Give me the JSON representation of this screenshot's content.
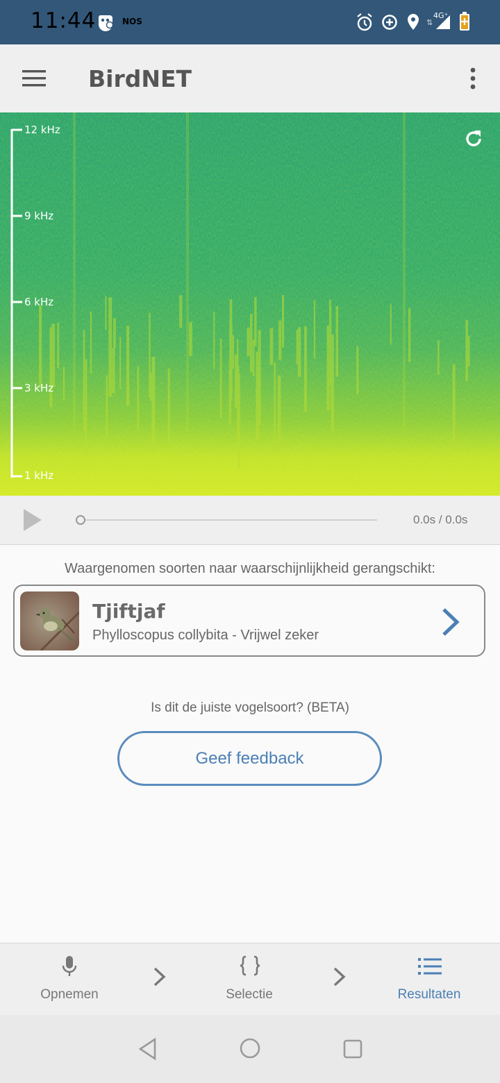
{
  "status_bar": {
    "time": "11:44",
    "carrier_badge": "NOS",
    "network": "4G⁺",
    "icons": [
      "game-icon",
      "alarm-icon",
      "data-saver-icon",
      "location-icon",
      "signal-icon",
      "battery-icon"
    ]
  },
  "app_bar": {
    "title": "BirdNET",
    "icons": [
      "menu-icon",
      "more-vert-icon"
    ]
  },
  "spectrogram": {
    "axis_labels": [
      "12 kHz",
      "9 kHz",
      "6 kHz",
      "3 kHz",
      "1 kHz"
    ],
    "icon": "refresh-icon"
  },
  "player": {
    "time": "0.0s / 0.0s",
    "progress": 0
  },
  "results": {
    "heading": "Waargenomen soorten naar waarschijnlijkheid gerangschikt:",
    "items": [
      {
        "name": "Tjiftjaf",
        "detail": "Phylloscopus collybita - Vrijwel zeker"
      }
    ]
  },
  "feedback": {
    "question": "Is dit de juiste vogelsoort? (BETA)",
    "button_label": "Geef feedback"
  },
  "bottom_nav": {
    "items": [
      {
        "label": "Opnemen",
        "icon": "mic-icon"
      },
      {
        "label": "Selectie",
        "icon": "braces-icon"
      },
      {
        "label": "Resultaten",
        "icon": "list-icon",
        "active": true
      }
    ]
  },
  "colors": {
    "status_bar": "#325779",
    "accent": "#4b7fb4",
    "spectrogram_low": "#2fa46e",
    "spectrogram_high": "#d6ea2a"
  }
}
